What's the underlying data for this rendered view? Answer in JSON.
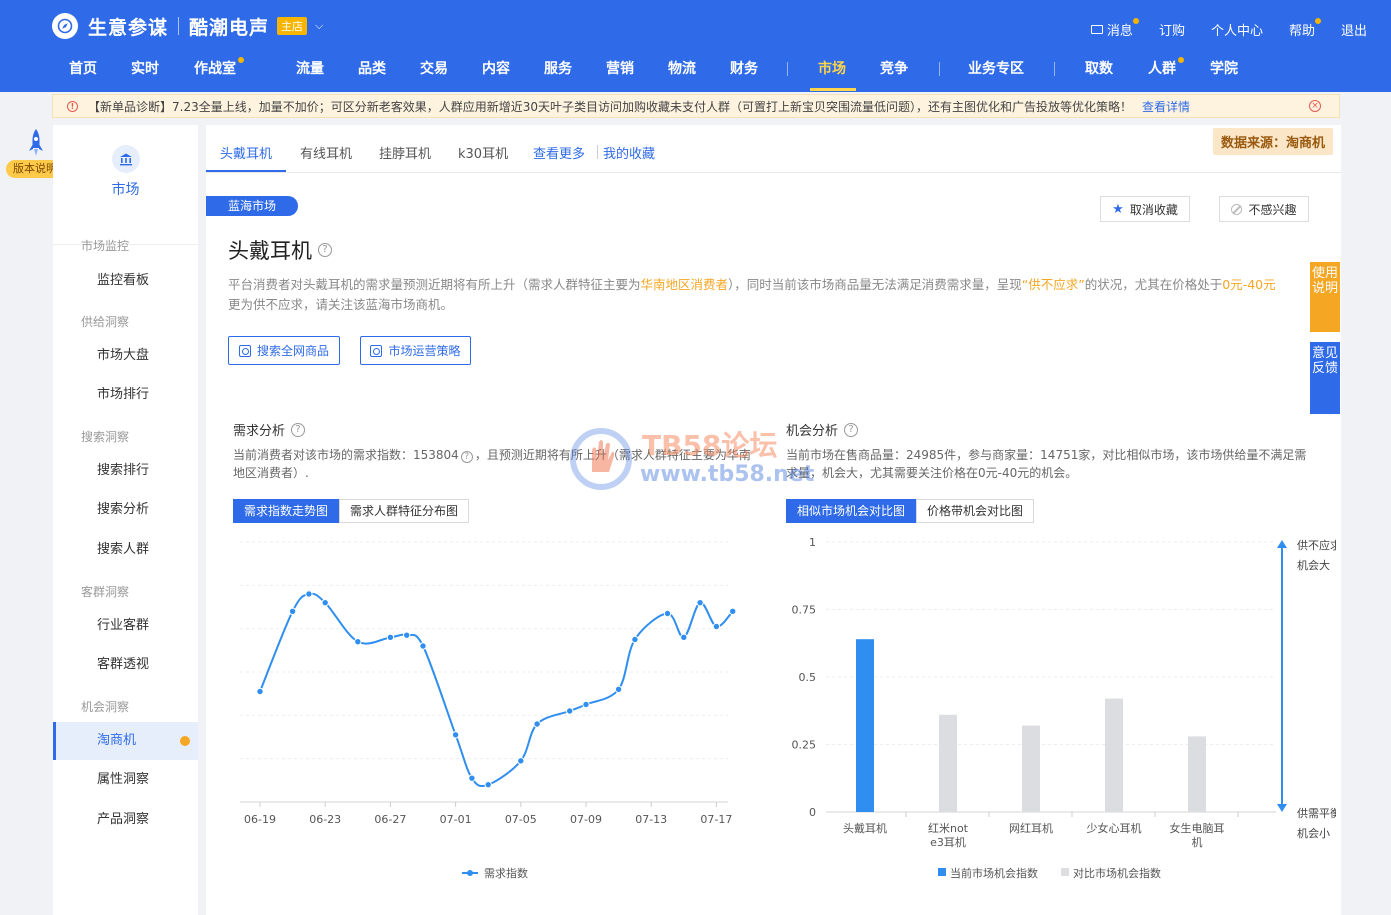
{
  "header": {
    "brand": "生意参谋",
    "shop": "酷潮电声",
    "shop_tag": "主店",
    "links": [
      {
        "label": "消息",
        "dot": true
      },
      {
        "label": "订购",
        "dot": false
      },
      {
        "label": "个人中心",
        "dot": false
      },
      {
        "label": "帮助",
        "dot": true
      },
      {
        "label": "退出",
        "dot": false
      }
    ],
    "nav": [
      {
        "label": "首页",
        "dot": false,
        "active": false
      },
      {
        "label": "实时",
        "dot": false,
        "active": false
      },
      {
        "label": "作战室",
        "dot": true,
        "active": false
      },
      {
        "label": "流量",
        "dot": false,
        "active": false
      },
      {
        "label": "品类",
        "dot": false,
        "active": false
      },
      {
        "label": "交易",
        "dot": false,
        "active": false
      },
      {
        "label": "内容",
        "dot": false,
        "active": false
      },
      {
        "label": "服务",
        "dot": false,
        "active": false
      },
      {
        "label": "营销",
        "dot": false,
        "active": false
      },
      {
        "label": "物流",
        "dot": false,
        "active": false
      },
      {
        "label": "财务",
        "dot": false,
        "active": false
      },
      {
        "label": "市场",
        "dot": false,
        "active": true
      },
      {
        "label": "竞争",
        "dot": false,
        "active": false
      },
      {
        "label": "业务专区",
        "dot": false,
        "active": false
      },
      {
        "label": "取数",
        "dot": false,
        "active": false
      },
      {
        "label": "人群",
        "dot": true,
        "active": false
      },
      {
        "label": "学院",
        "dot": false,
        "active": false
      }
    ]
  },
  "notice": {
    "text": "【新单品诊断】7.23全量上线，加量不加价；可区分新老客效果，人群应用新增近30天叶子类目访问加购收藏未支付人群（可置打上新宝贝突围流量低问题），还有主图优化和广告投放等优化策略！",
    "link": "查看详情"
  },
  "version_badge": "版本说明",
  "sidebar": {
    "module": "市场",
    "sections": [
      {
        "title": "市场监控",
        "items": [
          "监控看板"
        ]
      },
      {
        "title": "供给洞察",
        "items": [
          "市场大盘",
          "市场排行"
        ]
      },
      {
        "title": "搜索洞察",
        "items": [
          "搜索排行",
          "搜索分析",
          "搜索人群"
        ]
      },
      {
        "title": "客群洞察",
        "items": [
          "行业客群",
          "客群透视"
        ]
      },
      {
        "title": "机会洞察",
        "items": [
          "淘商机",
          "属性洞察",
          "产品洞察"
        ]
      }
    ],
    "active": "淘商机"
  },
  "subtabs": {
    "items": [
      "头戴耳机",
      "有线耳机",
      "挂脖耳机",
      "k30耳机"
    ],
    "more": "查看更多",
    "favorites": "我的收藏",
    "source": "数据来源：淘商机"
  },
  "market": {
    "ribbon": "蓝海市场",
    "unfav": "取消收藏",
    "not_interested": "不感兴趣",
    "title": "头戴耳机",
    "desc_1": "平台消费者对头戴耳机的需求量预测近期将有所上升（需求人群特征主要为",
    "desc_hl_1": "华南地区消费者",
    "desc_2": "），同时当前该市场商品量无法满足消费需求量，呈现",
    "desc_hl_2": "“供不应求”",
    "desc_3": "的状况，尤其在价格处于",
    "desc_hl_3": "0元-40元",
    "desc_4": "更为供不应求，请关注该蓝海市场商机。",
    "btn_search": "搜索全网商品",
    "btn_strategy": "市场运营策略"
  },
  "demand": {
    "title": "需求分析",
    "desc_a": "当前消费者对该市场的需求指数：153804",
    "desc_b": "，且预测近期将有所上升（需求人群特征主要为华南",
    "desc_c": "地区消费者）.",
    "tabs": [
      "需求指数走势图",
      "需求人群特征分布图"
    ]
  },
  "opportunity": {
    "title": "机会分析",
    "desc_a": "当前市场在售商品量：24985件，参与商家量：14751家，对比相似市场，该市场供给量不满足需",
    "desc_b": "求量，机会大，尤其需要关注价格在0元-40元的机会。",
    "tabs": [
      "相似市场机会对比图",
      "价格带机会对比图"
    ]
  },
  "float": {
    "usage": "使用说明",
    "feedback": "意见反馈"
  },
  "watermark": {
    "line1": "TB58论坛",
    "line2": "www.tb58.net"
  },
  "chart_data": [
    {
      "type": "line",
      "title": "",
      "x": [
        "06-19",
        "06-21",
        "06-22",
        "06-23",
        "06-25",
        "06-27",
        "06-28",
        "06-29",
        "07-01",
        "07-02",
        "07-03",
        "07-05",
        "07-06",
        "07-08",
        "07-09",
        "07-11",
        "07-12",
        "07-14",
        "07-15",
        "07-16",
        "07-17",
        "07-18"
      ],
      "xticks": [
        "06-19",
        "06-23",
        "06-27",
        "07-01",
        "07-05",
        "07-09",
        "07-13",
        "07-17"
      ],
      "series": [
        {
          "name": "需求指数",
          "values": [
            25.5,
            44,
            48,
            46,
            37,
            38,
            38.5,
            36,
            15.5,
            5.5,
            4,
            9.5,
            18,
            21,
            22.5,
            26,
            37.5,
            43.5,
            38,
            46,
            40.5,
            44
          ]
        }
      ],
      "ylim": [
        0,
        60
      ],
      "ygrid": [
        0,
        10,
        20,
        30,
        40,
        50,
        60
      ],
      "grid": true,
      "yaxis_labels": false,
      "legend": "bottom",
      "color": "#2f8ef0"
    },
    {
      "type": "bar",
      "title": "",
      "categories": [
        "头戴耳机",
        "红米not e3耳机",
        "网红耳机",
        "少女心耳机",
        "女生电脑耳机"
      ],
      "category_lines": [
        [
          "头戴耳机"
        ],
        [
          "红米not",
          "e3耳机"
        ],
        [
          "网红耳机"
        ],
        [
          "少女心耳机"
        ],
        [
          "女生电脑耳",
          "机"
        ]
      ],
      "series": [
        {
          "name": "当前市场机会指数",
          "values": [
            0.64,
            null,
            null,
            null,
            null
          ]
        },
        {
          "name": "对比市场机会指数",
          "values": [
            null,
            0.36,
            0.32,
            0.42,
            0.28
          ]
        }
      ],
      "yticks": [
        "0",
        "0.25",
        "0.5",
        "0.75",
        "1"
      ],
      "ylim": [
        0,
        1
      ],
      "colors": {
        "current": "#2f8ef0",
        "compare": "#dcdde0"
      },
      "annotations": {
        "top": [
          "供不应求",
          "机会大"
        ],
        "bottom": [
          "供需平衡",
          "机会小"
        ]
      },
      "legend": "bottom"
    }
  ]
}
